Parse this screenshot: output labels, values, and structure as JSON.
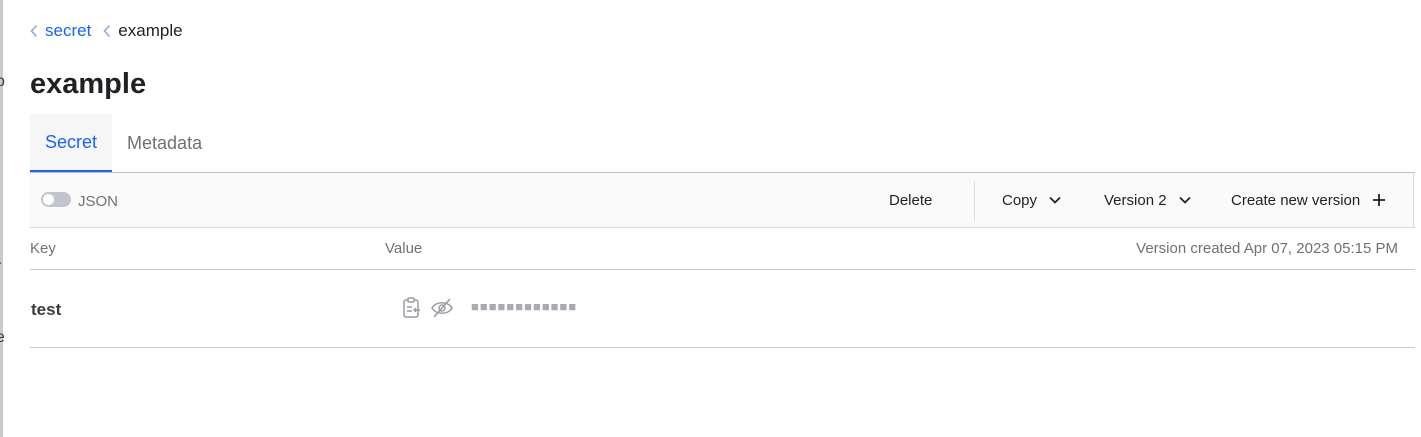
{
  "breadcrumbs": [
    {
      "label": "secret",
      "icon": "chevron-left-icon"
    },
    {
      "label": "example",
      "icon": "chevron-left-icon"
    }
  ],
  "page_title": "example",
  "tabs": [
    {
      "label": "Secret",
      "active": true
    },
    {
      "label": "Metadata",
      "active": false
    }
  ],
  "toolbar": {
    "json_toggle": {
      "label": "JSON",
      "enabled": false
    },
    "delete_label": "Delete",
    "copy_label": "Copy",
    "version_label": "Version 2",
    "create_label": "Create new version"
  },
  "table": {
    "key_header": "Key",
    "value_header": "Value",
    "version_created": "Version created Apr 07, 2023 05:15 PM",
    "rows": [
      {
        "key": "test",
        "masked_value": "■■■■■■■■■■■■",
        "icons": [
          "copy-clipboard-icon",
          "eye-off-icon"
        ]
      }
    ]
  },
  "colors": {
    "accent": "#1563ff",
    "text": "#1f2124",
    "muted": "#6f7176",
    "border": "#c9cacd"
  }
}
